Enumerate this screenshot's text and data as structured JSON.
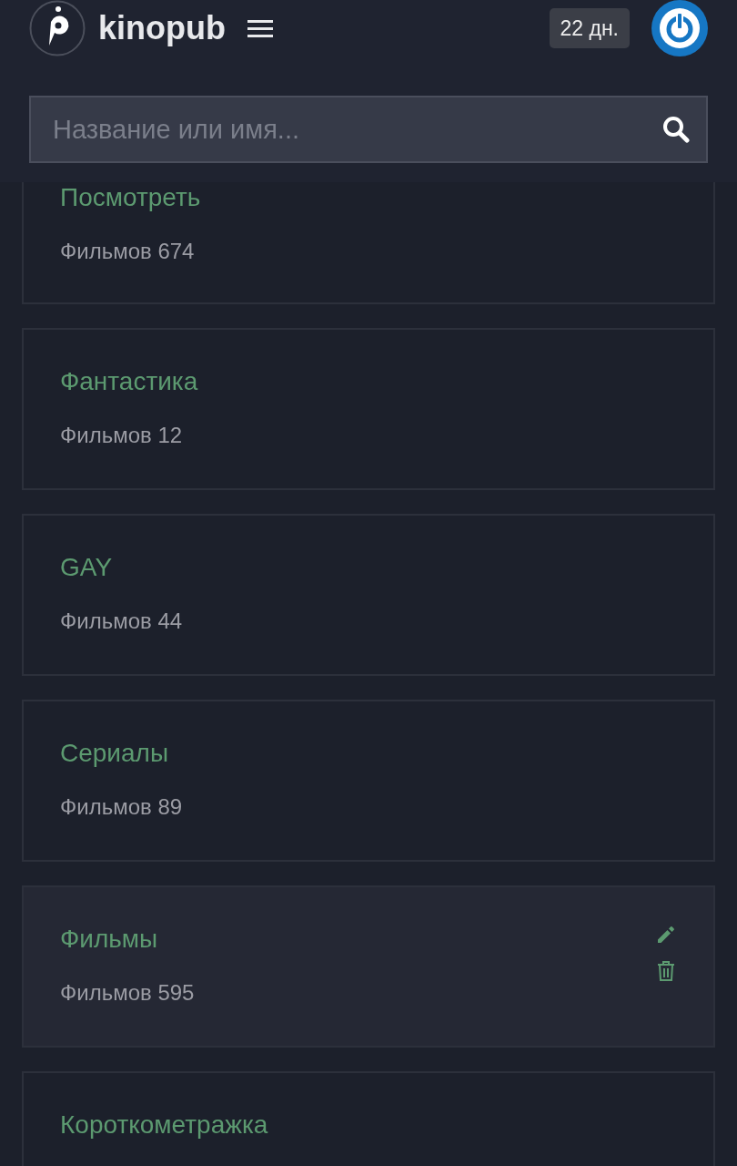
{
  "header": {
    "logo_text": "kinopub",
    "days_badge": "22 дн.",
    "search": {
      "placeholder": "Название или имя..."
    }
  },
  "collections": [
    {
      "title": "Посмотреть",
      "count": "Фильмов 674",
      "highlighted": false
    },
    {
      "title": "Фантастика",
      "count": "Фильмов 12",
      "highlighted": false
    },
    {
      "title": "GAY",
      "count": "Фильмов 44",
      "highlighted": false
    },
    {
      "title": "Сериалы",
      "count": "Фильмов 89",
      "highlighted": false
    },
    {
      "title": "Фильмы",
      "count": "Фильмов 595",
      "highlighted": true
    },
    {
      "title": "Короткометражка",
      "highlighted": false
    }
  ]
}
